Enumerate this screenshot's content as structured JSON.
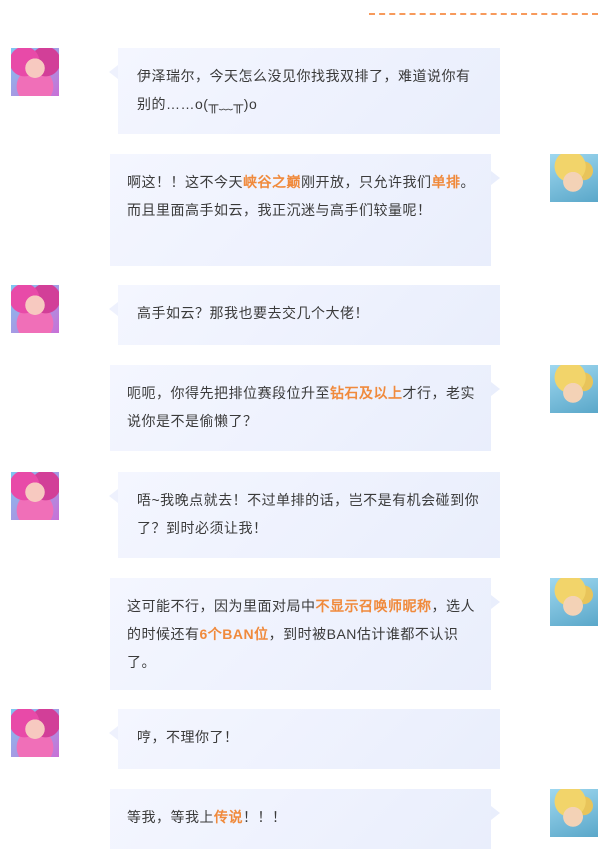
{
  "colors": {
    "highlight": "#f08a3c",
    "dash": "#f79a5c",
    "bubble": "#eef1fd"
  },
  "avatars": {
    "left": "lux-avatar",
    "right": "ezreal-avatar"
  },
  "messages": [
    {
      "side": "left",
      "parts": [
        {
          "t": "伊泽瑞尔，今天怎么没见你找我双排了，难道说你有别的……o(╥﹏╥)o"
        }
      ]
    },
    {
      "side": "right",
      "parts": [
        {
          "t": "啊这！！这不今天"
        },
        {
          "t": "峡谷之巅",
          "h": true
        },
        {
          "t": "刚开放，只允许我们"
        },
        {
          "t": "单排",
          "h": true
        },
        {
          "t": "。而且里面高手如云，我正沉迷与高手们较量呢！"
        }
      ]
    },
    {
      "side": "left",
      "parts": [
        {
          "t": "高手如云？那我也要去交几个大佬！"
        }
      ]
    },
    {
      "side": "right",
      "parts": [
        {
          "t": "呃呃，你得先把排位赛段位升至"
        },
        {
          "t": "钻石及以上",
          "h": true
        },
        {
          "t": "才行，老实说你是不是偷懒了？"
        }
      ]
    },
    {
      "side": "left",
      "parts": [
        {
          "t": "唔~我晚点就去！不过单排的话，岂不是有机会碰到你了？到时必须让我！"
        }
      ]
    },
    {
      "side": "right",
      "parts": [
        {
          "t": "这可能不行，因为里面对局中"
        },
        {
          "t": "不显示召唤师昵称",
          "h": true
        },
        {
          "t": "，选人的时候还有"
        },
        {
          "t": "6个BAN位",
          "h": true
        },
        {
          "t": "，到时被BAN估计谁都不认识了。"
        }
      ]
    },
    {
      "side": "left",
      "parts": [
        {
          "t": "哼，不理你了！"
        }
      ]
    },
    {
      "side": "right",
      "parts": [
        {
          "t": "等我，等我上"
        },
        {
          "t": "传说",
          "h": true
        },
        {
          "t": "！！！"
        }
      ]
    }
  ]
}
